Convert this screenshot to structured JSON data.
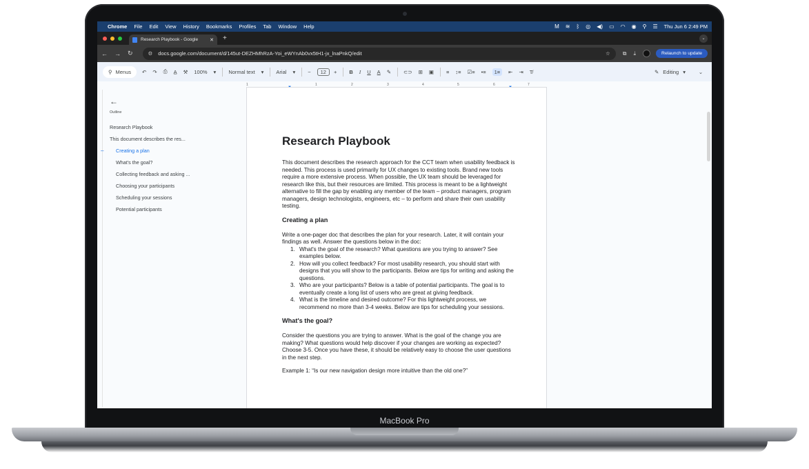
{
  "macos_menubar": {
    "items": [
      "Chrome",
      "File",
      "Edit",
      "View",
      "History",
      "Bookmarks",
      "Profiles",
      "Tab",
      "Window",
      "Help"
    ],
    "clock": "Thu Jun 6  2:49 PM"
  },
  "browser": {
    "tab_title": "Research Playbook - Google",
    "url": "docs.google.com/document/d/145ut-DEZHMhRzA-Yoi_eWYnAb0vx5tH1-jx_lnaPnkQ/edit",
    "relaunch_label": "Relaunch to update"
  },
  "docs_toolbar": {
    "menus_label": "Menus",
    "zoom": "100%",
    "style": "Normal text",
    "font": "Arial",
    "font_size": "12",
    "mode": "Editing"
  },
  "ruler": {
    "ticks": [
      "1",
      "1",
      "2",
      "3",
      "4",
      "5",
      "6",
      "7"
    ]
  },
  "outline": {
    "title": "Outline",
    "items": [
      "Research Playbook",
      "This document describes the res...",
      "Creating a plan",
      "What's the goal?",
      "Collecting feedback and asking ...",
      "Choosing your participants",
      "Scheduling your sessions",
      "Potential participants"
    ]
  },
  "document": {
    "title": "Research Playbook",
    "intro": "This document describes the research approach for the CCT team when usability feedback is needed. This process is used primarily for UX changes to existing tools. Brand new tools require a more extensive process. When possible, the UX team should be leveraged for research like this, but their resources are limited. This process is meant to be a lightweight alternative to fill the gap by enabling any member of the team – product managers, program managers, design technologists, engineers, etc – to perform and share their own usability testing.",
    "section1_heading": "Creating a plan",
    "section1_body": "Write a one-pager doc that describes the plan for your research. Later, it will contain your findings as well. Answer the questions below in the doc:",
    "list": [
      "What's the goal of the research? What questions are you trying to answer? See examples below.",
      "How will you collect feedback? For most usability research, you should start with designs that you will show to the participants. Below are tips for writing and asking the questions.",
      "Who are your participants? Below is a table of potential participants. The goal is to eventually create a long list of users who are great at giving feedback.",
      "What is the timeline and desired outcome? For this lightweight process, we recommend no more than 3-4 weeks. Below are tips for scheduling your sessions."
    ],
    "section2_heading": "What's the goal?",
    "section2_body": "Consider the questions you are trying to answer. What is the goal of the change you are making? What questions would help discover if your changes are working as expected? Choose 3-5. Once you have these, it should be relatively easy to choose the user questions in the next step.",
    "example1": "Example 1: “Is our new navigation design more intuitive than the old one?”"
  },
  "device_label": "MacBook Pro"
}
